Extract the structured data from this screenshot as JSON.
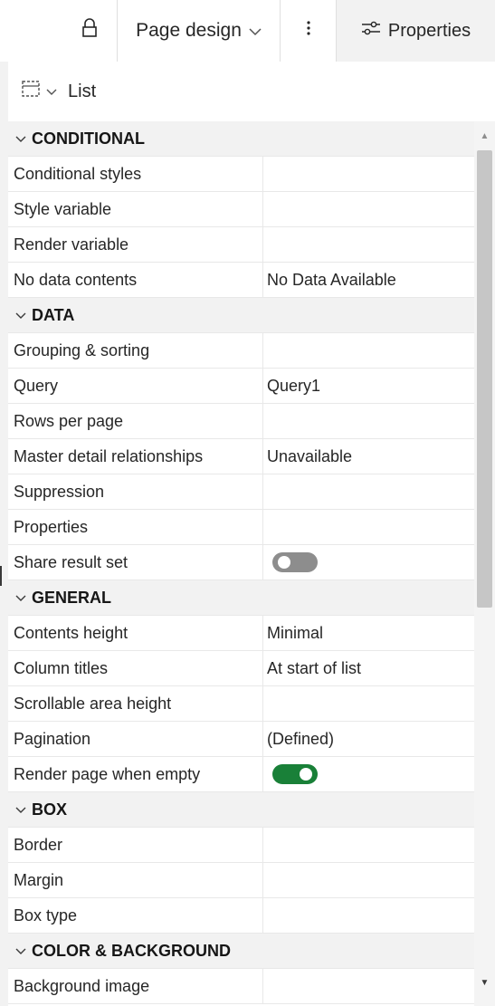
{
  "toolbar": {
    "lock_icon": "lock-icon",
    "page_design_label": "Page design",
    "page_design_chevron": "chevron-down-icon",
    "more_icon": "overflow-menu-vertical-icon",
    "properties_icon": "settings-adjust-icon",
    "properties_label": "Properties"
  },
  "panel": {
    "object_type_icon": "list-select-icon",
    "object_label": "List"
  },
  "sections": [
    {
      "title": "CONDITIONAL",
      "rows": [
        {
          "name": "Conditional styles",
          "value": ""
        },
        {
          "name": "Style variable",
          "value": ""
        },
        {
          "name": "Render variable",
          "value": ""
        },
        {
          "name": "No data contents",
          "value": "No Data Available"
        }
      ]
    },
    {
      "title": "DATA",
      "rows": [
        {
          "name": "Grouping & sorting",
          "value": ""
        },
        {
          "name": "Query",
          "value": "Query1"
        },
        {
          "name": "Rows per page",
          "value": ""
        },
        {
          "name": "Master detail relationships",
          "value": "Unavailable"
        },
        {
          "name": "Suppression",
          "value": ""
        },
        {
          "name": "Properties",
          "value": ""
        },
        {
          "name": "Share result set",
          "value": "",
          "toggle": "off"
        }
      ]
    },
    {
      "title": "GENERAL",
      "rows": [
        {
          "name": "Contents height",
          "value": "Minimal"
        },
        {
          "name": "Column titles",
          "value": "At start of list"
        },
        {
          "name": "Scrollable area height",
          "value": ""
        },
        {
          "name": "Pagination",
          "value": "(Defined)"
        },
        {
          "name": "Render page when empty",
          "value": "",
          "toggle": "on"
        }
      ]
    },
    {
      "title": "BOX",
      "rows": [
        {
          "name": "Border",
          "value": ""
        },
        {
          "name": "Margin",
          "value": ""
        },
        {
          "name": "Box type",
          "value": ""
        }
      ]
    },
    {
      "title": "COLOR & BACKGROUND",
      "rows": [
        {
          "name": "Background image",
          "value": ""
        }
      ]
    }
  ],
  "colors": {
    "toggle_on": "#198038",
    "toggle_off": "#8d8d8d",
    "section_background": "#f2f2f2"
  }
}
